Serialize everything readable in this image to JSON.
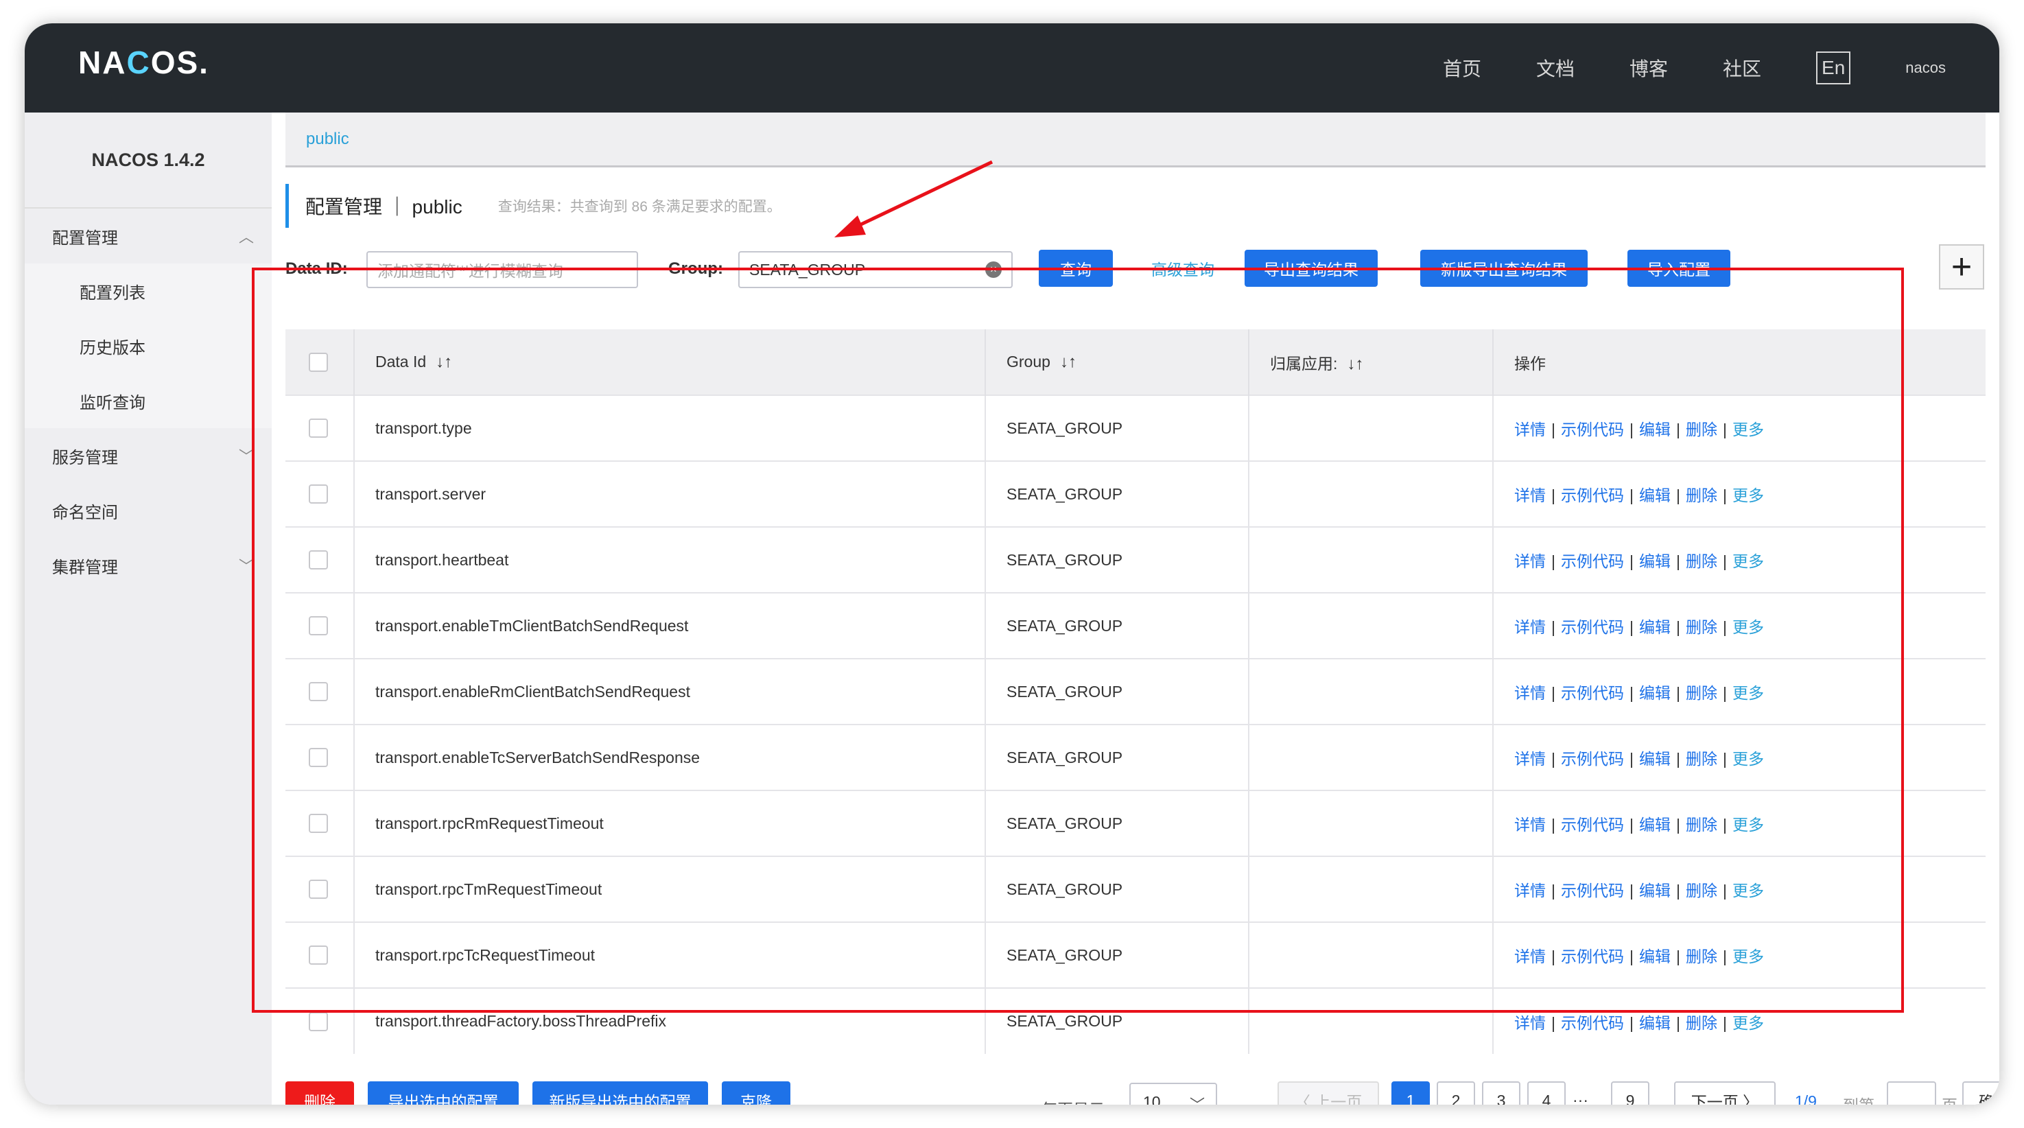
{
  "header": {
    "logo": "NACOS.",
    "nav": [
      "首页",
      "文档",
      "博客",
      "社区"
    ],
    "lang": "En",
    "user": "nacos"
  },
  "sidebar": {
    "title": "NACOS 1.4.2",
    "items": [
      {
        "label": "配置管理",
        "sub": false,
        "chevron": "up"
      },
      {
        "label": "配置列表",
        "sub": true
      },
      {
        "label": "历史版本",
        "sub": true
      },
      {
        "label": "监听查询",
        "sub": true
      },
      {
        "label": "服务管理",
        "sub": false,
        "chevron": "down"
      },
      {
        "label": "命名空间",
        "sub": false
      },
      {
        "label": "集群管理",
        "sub": false,
        "chevron": "down"
      }
    ]
  },
  "breadcrumb": "public",
  "page_title": "配置管理 ｜ public",
  "query_summary": "查询结果：共查询到 86 条满足要求的配置。",
  "search": {
    "data_id_label": "Data ID:",
    "data_id_placeholder": "添加通配符'*'进行模糊查询",
    "group_label": "Group:",
    "group_value": "SEATA_GROUP",
    "query_button": "查询",
    "advanced_query": "高级查询",
    "export_results": "导出查询结果",
    "new_export_results": "新版导出查询结果",
    "import_config": "导入配置",
    "add_icon": "+"
  },
  "table": {
    "columns": [
      "Data Id",
      "Group",
      "归属应用:",
      "操作"
    ],
    "sort_icon": "↓↑",
    "rows": [
      {
        "data_id": "transport.type",
        "group": "SEATA_GROUP",
        "app": ""
      },
      {
        "data_id": "transport.server",
        "group": "SEATA_GROUP",
        "app": ""
      },
      {
        "data_id": "transport.heartbeat",
        "group": "SEATA_GROUP",
        "app": ""
      },
      {
        "data_id": "transport.enableTmClientBatchSendRequest",
        "group": "SEATA_GROUP",
        "app": ""
      },
      {
        "data_id": "transport.enableRmClientBatchSendRequest",
        "group": "SEATA_GROUP",
        "app": ""
      },
      {
        "data_id": "transport.enableTcServerBatchSendResponse",
        "group": "SEATA_GROUP",
        "app": ""
      },
      {
        "data_id": "transport.rpcRmRequestTimeout",
        "group": "SEATA_GROUP",
        "app": ""
      },
      {
        "data_id": "transport.rpcTmRequestTimeout",
        "group": "SEATA_GROUP",
        "app": ""
      },
      {
        "data_id": "transport.rpcTcRequestTimeout",
        "group": "SEATA_GROUP",
        "app": ""
      },
      {
        "data_id": "transport.threadFactory.bossThreadPrefix",
        "group": "SEATA_GROUP",
        "app": ""
      }
    ],
    "operations": [
      "详情",
      "示例代码",
      "编辑",
      "删除",
      "更多"
    ]
  },
  "footer": {
    "delete": "删除",
    "export_selected": "导出选中的配置",
    "new_export_selected": "新版导出选中的配置",
    "clone": "克隆",
    "page_size_label": "每页显示:",
    "page_size": "10",
    "prev": "上一页",
    "pages": [
      "1",
      "2",
      "3",
      "4"
    ],
    "ellipsis": "···",
    "last_page": "9",
    "next": "下一页",
    "page_info": "1/9",
    "goto_label": "到第",
    "page_unit": "页",
    "confirm": "确定"
  },
  "colors": {
    "topbar": "#252a2f",
    "primary": "#1e72e8",
    "danger": "#ee1b1b",
    "annotation": "#e8111a"
  }
}
